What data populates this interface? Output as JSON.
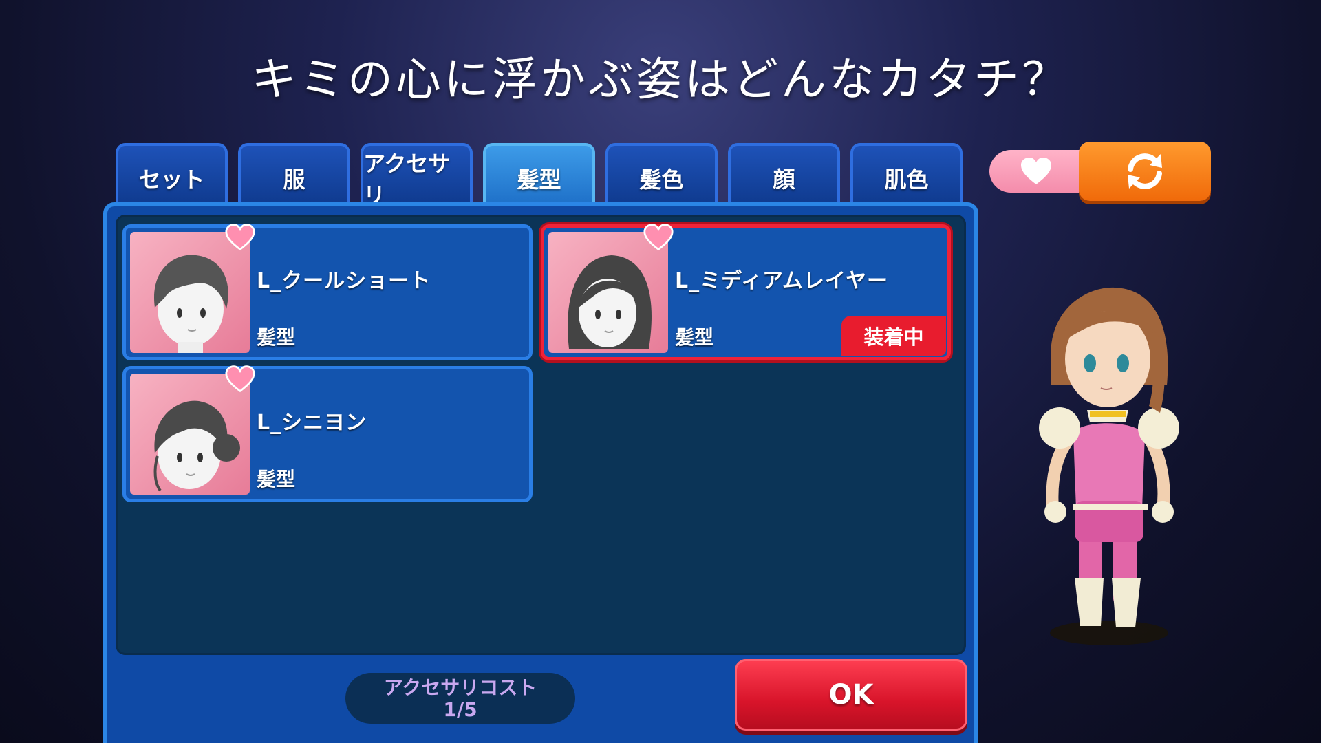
{
  "title": "キミの心に浮かぶ姿はどんなカタチ？",
  "tabs": [
    {
      "label": "セット",
      "active": false
    },
    {
      "label": "服",
      "active": false
    },
    {
      "label": "アクセサリ",
      "active": false
    },
    {
      "label": "髪型",
      "active": true
    },
    {
      "label": "髪色",
      "active": false
    },
    {
      "label": "顔",
      "active": false
    },
    {
      "label": "肌色",
      "active": false
    }
  ],
  "items": [
    {
      "name": "L_クールショート",
      "category": "髪型",
      "equipped": false
    },
    {
      "name": "L_ミディアムレイヤー",
      "category": "髪型",
      "equipped": true,
      "badge": "装着中"
    },
    {
      "name": "L_シニヨン",
      "category": "髪型",
      "equipped": false
    }
  ],
  "cost": {
    "label": "アクセサリコスト",
    "value": "1/5"
  },
  "ok_label": "OK",
  "icons": {
    "favorite": "heart-icon",
    "refresh": "refresh-icon"
  },
  "colors": {
    "accent": "#2a7ee6",
    "equipped": "#e81c2e",
    "ok": "#d8142a",
    "refresh": "#f06a0a",
    "favorite": "#f48cab"
  }
}
